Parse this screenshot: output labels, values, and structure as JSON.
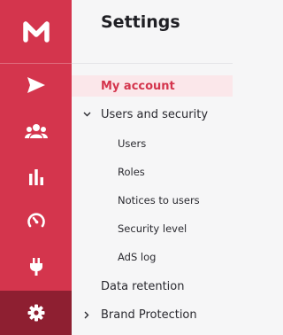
{
  "colors": {
    "rail": "#d4354d",
    "rail_active": "#8e1f31",
    "accent": "#d4354d",
    "active_bg": "#fbe7ea"
  },
  "rail": {
    "logo_icon": "brand-m-logo",
    "items": [
      {
        "icon": "send-icon",
        "active": false
      },
      {
        "icon": "users-group-icon",
        "active": false
      },
      {
        "icon": "bar-chart-icon",
        "active": false
      },
      {
        "icon": "gauge-icon",
        "active": false
      },
      {
        "icon": "plug-icon",
        "active": false
      },
      {
        "icon": "gear-icon",
        "active": true
      }
    ]
  },
  "settings": {
    "title": "Settings",
    "items": {
      "my_account": "My account",
      "users_and_security": "Users and security",
      "users": "Users",
      "roles": "Roles",
      "notices_to_users": "Notices to users",
      "security_level": "Security level",
      "ads_log": "AdS log",
      "data_retention": "Data retention",
      "brand_protection": "Brand Protection"
    }
  }
}
